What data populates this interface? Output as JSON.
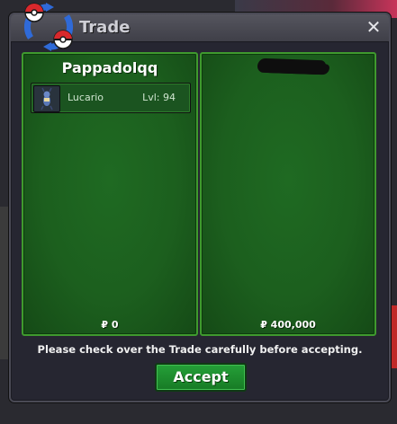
{
  "window": {
    "title": "Trade",
    "close_icon": "close-icon"
  },
  "left_panel": {
    "trader_name": "Pappadolqq",
    "items": [
      {
        "icon": "lucario-sprite-icon",
        "name": "Lucario",
        "level": "Lvl: 94"
      }
    ],
    "money": "₽ 0"
  },
  "right_panel": {
    "trader_name_redacted": true,
    "money": "₽ 400,000"
  },
  "footer": {
    "notice": "Please check over the Trade carefully before accepting.",
    "accept_label": "Accept"
  },
  "colors": {
    "panel_green": "#1c5f1e",
    "panel_border": "#3f9a2e",
    "accept_green": "#1f8c2e",
    "window_bg": "#262631"
  }
}
